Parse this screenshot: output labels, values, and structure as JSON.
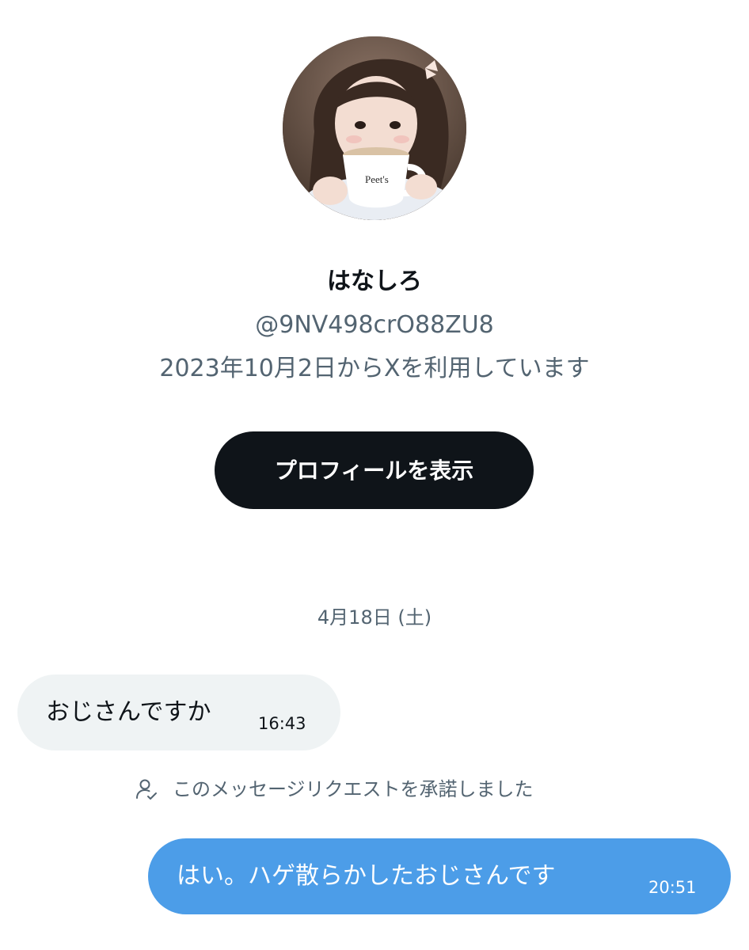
{
  "profile": {
    "avatar_icon": "user-photo-avatar",
    "display_name": "はなしろ",
    "handle": "@9NV498crO88ZU8",
    "joined": "2023年10月2日からXを利用しています",
    "view_profile_label": "プロフィールを表示"
  },
  "conversation": {
    "date_label": "4月18日 (土)",
    "messages": [
      {
        "direction": "incoming",
        "text": "おじさんですか",
        "time": "16:43"
      },
      {
        "direction": "outgoing",
        "text": "はい。ハゲ散らかしたおじさんです",
        "time": "20:51"
      }
    ],
    "system_notice": {
      "icon": "person-check-icon",
      "text": "このメッセージリクエストを承諾しました"
    }
  },
  "colors": {
    "primary_text": "#0f1419",
    "secondary_text": "#536471",
    "button_bg": "#0f1419",
    "incoming_bubble": "#eff3f4",
    "outgoing_bubble": "#4c9de8"
  }
}
